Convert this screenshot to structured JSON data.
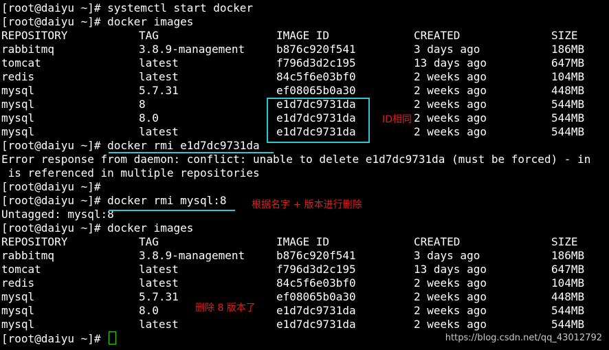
{
  "terminal": {
    "lines": [
      {
        "type": "prompt",
        "prompt": "[root@daiyu ~]# ",
        "command": "systemctl start docker"
      },
      {
        "type": "prompt",
        "prompt": "[root@daiyu ~]# ",
        "command": "docker images"
      },
      {
        "type": "row",
        "cols": [
          "REPOSITORY",
          "TAG",
          "IMAGE ID",
          "CREATED",
          "SIZE"
        ]
      },
      {
        "type": "row",
        "cols": [
          "rabbitmq",
          "3.8.9-management",
          "b876c920f541",
          "3 days ago",
          "186MB"
        ]
      },
      {
        "type": "row",
        "cols": [
          "tomcat",
          "latest",
          "f796d3d2c195",
          "13 days ago",
          "647MB"
        ]
      },
      {
        "type": "row",
        "cols": [
          "redis",
          "latest",
          "84c5f6e03bf0",
          "2 weeks ago",
          "104MB"
        ]
      },
      {
        "type": "row",
        "cols": [
          "mysql",
          "5.7.31",
          "ef08065b0a30",
          "2 weeks ago",
          "448MB"
        ]
      },
      {
        "type": "row",
        "cols": [
          "mysql",
          "8",
          "e1d7dc9731da",
          "2 weeks ago",
          "544MB"
        ]
      },
      {
        "type": "row",
        "cols": [
          "mysql",
          "8.0",
          "e1d7dc9731da",
          "2 weeks ago",
          "544MB"
        ]
      },
      {
        "type": "row",
        "cols": [
          "mysql",
          "latest",
          "e1d7dc9731da",
          "2 weeks ago",
          "544MB"
        ]
      },
      {
        "type": "prompt",
        "prompt": "[root@daiyu ~]# ",
        "command": "docker rmi e1d7dc9731da"
      },
      {
        "type": "text",
        "text": "Error response from daemon: conflict: unable to delete e1d7dc9731da (must be forced) - in"
      },
      {
        "type": "text",
        "text": " is referenced in multiple repositories"
      },
      {
        "type": "prompt",
        "prompt": "[root@daiyu ~]# ",
        "command": ""
      },
      {
        "type": "prompt",
        "prompt": "[root@daiyu ~]# ",
        "command": "docker rmi mysql:8"
      },
      {
        "type": "text",
        "text": "Untagged: mysql:8"
      },
      {
        "type": "prompt",
        "prompt": "[root@daiyu ~]# ",
        "command": "docker images"
      },
      {
        "type": "row",
        "cols": [
          "REPOSITORY",
          "TAG",
          "IMAGE ID",
          "CREATED",
          "SIZE"
        ]
      },
      {
        "type": "row",
        "cols": [
          "rabbitmq",
          "3.8.9-management",
          "b876c920f541",
          "3 days ago",
          "186MB"
        ]
      },
      {
        "type": "row",
        "cols": [
          "tomcat",
          "latest",
          "f796d3d2c195",
          "13 days ago",
          "647MB"
        ]
      },
      {
        "type": "row",
        "cols": [
          "redis",
          "latest",
          "84c5f6e03bf0",
          "2 weeks ago",
          "104MB"
        ]
      },
      {
        "type": "row",
        "cols": [
          "mysql",
          "5.7.31",
          "ef08065b0a30",
          "2 weeks ago",
          "448MB"
        ]
      },
      {
        "type": "row",
        "cols": [
          "mysql",
          "8.0",
          "e1d7dc9731da",
          "2 weeks ago",
          "544MB"
        ]
      },
      {
        "type": "row",
        "cols": [
          "mysql",
          "latest",
          "e1d7dc9731da",
          "2 weeks ago",
          "544MB"
        ]
      },
      {
        "type": "prompt",
        "prompt": "[root@daiyu ~]# ",
        "command": "",
        "cursor": true
      }
    ]
  },
  "annotations": {
    "same_id": "ID相同",
    "delete_by_name": "根据名字 + 版本进行删除",
    "deleted_8": "删除 8 版本了"
  },
  "watermark": "https://blog.csdn.net/qq_43012792",
  "colors": {
    "background": "#000000",
    "text": "#ffffff",
    "annotation_text": "#e02020",
    "highlight": "#2fc7d2",
    "cursor": "#2bd900"
  }
}
